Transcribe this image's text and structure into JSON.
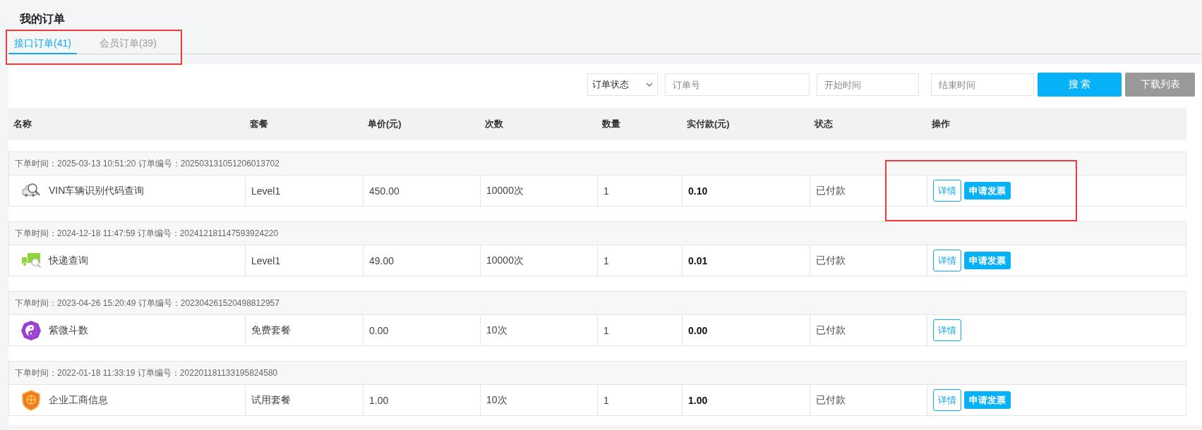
{
  "page_title": "我的订单",
  "tabs": {
    "highlighted": true,
    "items": [
      {
        "label": "接口订单(41)",
        "selected": true
      },
      {
        "label": "会员订单(39)",
        "selected": false
      }
    ]
  },
  "filters": {
    "status_select": "订单状态",
    "order_no": {
      "placeholder": "订单号"
    },
    "start_time": {
      "placeholder": "开始时间"
    },
    "end_time": {
      "placeholder": "结束时间"
    },
    "buttons": [
      {
        "label": "搜 索",
        "kind": "primary"
      },
      {
        "label": "下载列表",
        "kind": "secondary"
      }
    ]
  },
  "table": {
    "columns": [
      "名称",
      "套餐",
      "单价(元)",
      "次数",
      "数量",
      "实付款(元)",
      "状态",
      "操作"
    ],
    "orders": [
      {
        "meta": "下单时间：2025-03-13 10:51:20 订单编号：202503131051206013702",
        "kind": "car",
        "name": "VIN车辆识别代码查询",
        "plan": "Level1",
        "price": "450.00",
        "calls": "10000次",
        "quantity": "1",
        "paid": "0.10",
        "status": "已付款",
        "highlighted": true,
        "actions": [
          {
            "label": "详情",
            "kind": "outline"
          },
          {
            "label": "申请发票",
            "kind": "filled"
          }
        ]
      },
      {
        "meta": "下单时间：2024-12-18 11:47:59 订单编号：202412181147593924220",
        "kind": "truck",
        "name": "快递查询",
        "plan": "Level1",
        "price": "49.00",
        "calls": "10000次",
        "quantity": "1",
        "paid": "0.01",
        "status": "已付款",
        "highlighted": false,
        "actions": [
          {
            "label": "详情",
            "kind": "outline"
          },
          {
            "label": "申请发票",
            "kind": "filled"
          }
        ]
      },
      {
        "meta": "下单时间：2023-04-26 15:20:49 订单编号：202304261520498812957",
        "kind": "taiji",
        "name": "紫微斗数",
        "plan": "免费套餐",
        "price": "0.00",
        "calls": "10次",
        "quantity": "1",
        "paid": "0.00",
        "status": "已付款",
        "highlighted": false,
        "actions": [
          {
            "label": "详情",
            "kind": "outline"
          }
        ]
      },
      {
        "meta": "下单时间：2022-01-18 11:33:19 订单编号：202201181133195824580",
        "kind": "shield",
        "name": "企业工商信息",
        "plan": "试用套餐",
        "price": "1.00",
        "calls": "10次",
        "quantity": "1",
        "paid": "1.00",
        "status": "已付款",
        "highlighted": false,
        "actions": [
          {
            "label": "详情",
            "kind": "outline"
          },
          {
            "label": "申请发票",
            "kind": "filled"
          }
        ]
      }
    ]
  }
}
